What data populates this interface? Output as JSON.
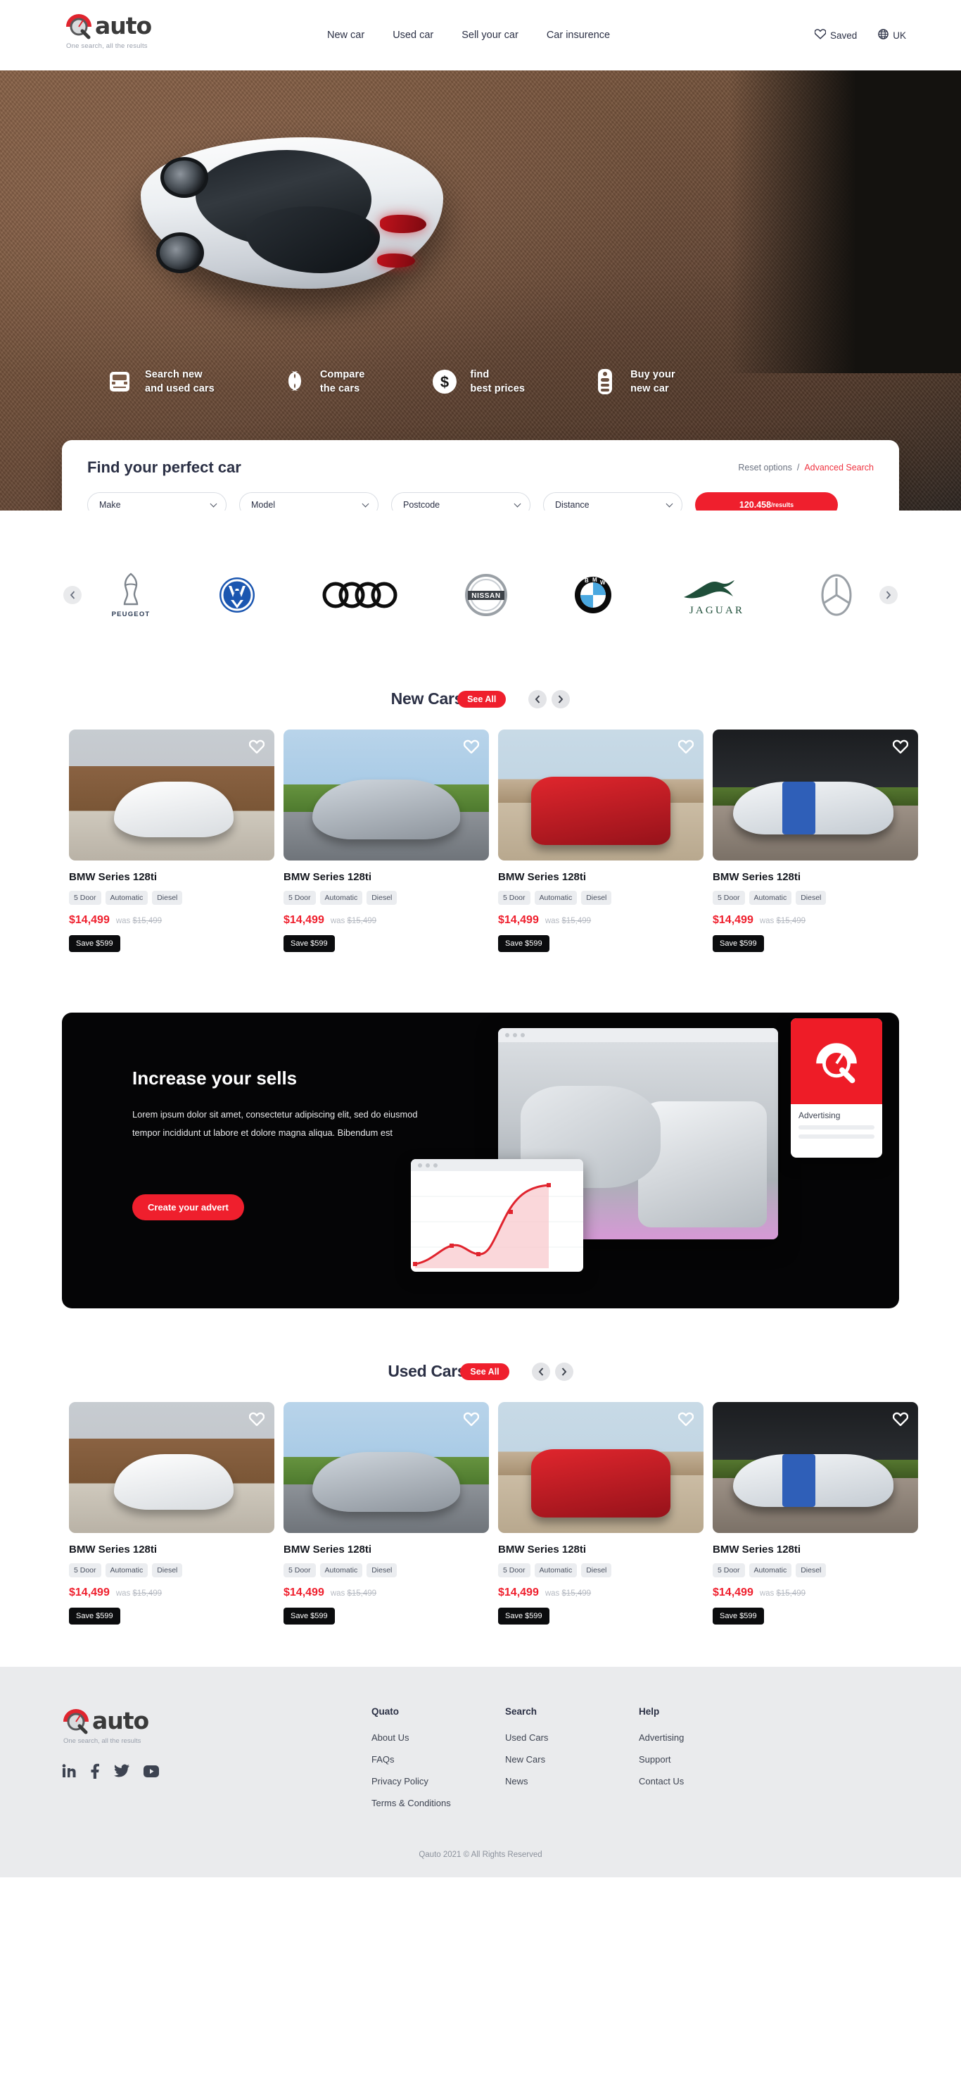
{
  "header": {
    "logo": {
      "text": "auto",
      "tagline": "One search, all the results",
      "icon": "speedometer-search-icon"
    },
    "nav": [
      {
        "label": "New car"
      },
      {
        "label": "Used car"
      },
      {
        "label": "Sell your car"
      },
      {
        "label": "Car insurence"
      }
    ],
    "saved": {
      "label": "Saved",
      "icon": "heart-icon"
    },
    "region": {
      "label": "UK",
      "icon": "globe-icon"
    }
  },
  "hero": {
    "features": [
      {
        "icon": "car-front-icon",
        "line1": "Search new",
        "line2": "and used cars"
      },
      {
        "icon": "compare-arrows-icon",
        "line1": "Compare",
        "line2": "the cars"
      },
      {
        "icon": "dollar-coin-icon",
        "line1": "find",
        "line2": "best prices"
      },
      {
        "icon": "car-key-icon",
        "line1": "Buy your",
        "line2": "new car"
      }
    ]
  },
  "search": {
    "title": "Find your perfect car",
    "reset_label": "Reset options",
    "separator": "/",
    "advanced_label": "Advanced Search",
    "fields": [
      {
        "name": "make",
        "value": "Make"
      },
      {
        "name": "model",
        "value": "Model"
      },
      {
        "name": "postcode",
        "value": "Postcode"
      },
      {
        "name": "distance",
        "value": "Distance"
      }
    ],
    "submit_count": "120.458",
    "submit_suffix": "/results"
  },
  "brands": {
    "prev_icon": "chevron-left-icon",
    "next_icon": "chevron-right-icon",
    "items": [
      {
        "name": "Peugeot",
        "label": "PEUGEOT"
      },
      {
        "name": "Volkswagen",
        "label": "VW"
      },
      {
        "name": "Audi",
        "label": ""
      },
      {
        "name": "Nissan",
        "label": "NISSAN"
      },
      {
        "name": "BMW",
        "label": ""
      },
      {
        "name": "Jaguar",
        "label": "JAGUAR"
      },
      {
        "name": "Mercedes-Benz",
        "label": ""
      }
    ]
  },
  "new_cars": {
    "title": "New Cars",
    "see_all": "See All",
    "prev_icon": "chevron-left-icon",
    "next_icon": "chevron-right-icon",
    "cars": [
      {
        "title": "BMW Series 128ti",
        "chips": [
          "5 Door",
          "Automatic",
          "Diesel"
        ],
        "price": "$14,499",
        "was_label": "was",
        "was_price": "$15,499",
        "save": "Save $599",
        "favourite_icon": "heart-icon"
      },
      {
        "title": "BMW Series 128ti",
        "chips": [
          "5 Door",
          "Automatic",
          "Diesel"
        ],
        "price": "$14,499",
        "was_label": "was",
        "was_price": "$15,499",
        "save": "Save $599",
        "favourite_icon": "heart-icon"
      },
      {
        "title": "BMW Series 128ti",
        "chips": [
          "5 Door",
          "Automatic",
          "Diesel"
        ],
        "price": "$14,499",
        "was_label": "was",
        "was_price": "$15,499",
        "save": "Save $599",
        "favourite_icon": "heart-icon"
      },
      {
        "title": "BMW Series 128ti",
        "chips": [
          "5 Door",
          "Automatic",
          "Diesel"
        ],
        "price": "$14,499",
        "was_label": "was",
        "was_price": "$15,499",
        "save": "Save $599",
        "favourite_icon": "heart-icon"
      }
    ]
  },
  "advert": {
    "title": "Increase your sells",
    "text": "Lorem ipsum dolor sit amet, consectetur adipiscing elit, sed do eiusmod tempor incididunt ut labore et dolore magna aliqua. Bibendum est",
    "button": "Create your advert",
    "card_label": "Advertising",
    "card_icon": "speedometer-search-icon"
  },
  "used_cars": {
    "title": "Used Cars",
    "see_all": "See All",
    "prev_icon": "chevron-left-icon",
    "next_icon": "chevron-right-icon",
    "cars": [
      {
        "title": "BMW Series 128ti",
        "chips": [
          "5 Door",
          "Automatic",
          "Diesel"
        ],
        "price": "$14,499",
        "was_label": "was",
        "was_price": "$15,499",
        "save": "Save $599",
        "favourite_icon": "heart-icon"
      },
      {
        "title": "BMW Series 128ti",
        "chips": [
          "5 Door",
          "Automatic",
          "Diesel"
        ],
        "price": "$14,499",
        "was_label": "was",
        "was_price": "$15,499",
        "save": "Save $599",
        "favourite_icon": "heart-icon"
      },
      {
        "title": "BMW Series 128ti",
        "chips": [
          "5 Door",
          "Automatic",
          "Diesel"
        ],
        "price": "$14,499",
        "was_label": "was",
        "was_price": "$15,499",
        "save": "Save $599",
        "favourite_icon": "heart-icon"
      },
      {
        "title": "BMW Series 128ti",
        "chips": [
          "5 Door",
          "Automatic",
          "Diesel"
        ],
        "price": "$14,499",
        "was_label": "was",
        "was_price": "$15,499",
        "save": "Save $599",
        "favourite_icon": "heart-icon"
      }
    ]
  },
  "footer": {
    "logo": {
      "text": "auto",
      "tagline": "One search, all the results"
    },
    "socials": [
      {
        "name": "linkedin-icon",
        "glyph": "in"
      },
      {
        "name": "facebook-icon",
        "glyph": "f"
      },
      {
        "name": "twitter-icon",
        "glyph": ""
      },
      {
        "name": "youtube-icon",
        "glyph": ""
      }
    ],
    "columns": [
      {
        "head": "Quato",
        "links": [
          "About Us",
          "FAQs",
          "Privacy Policy",
          "Terms & Conditions"
        ]
      },
      {
        "head": "Search",
        "links": [
          "Used Cars",
          "New Cars",
          "News"
        ]
      },
      {
        "head": "Help",
        "links": [
          "Advertising",
          "Support",
          "Contact Us"
        ]
      }
    ],
    "copyright": "Qauto 2021 © All Rights Reserved"
  },
  "colors": {
    "accent_red": "#ef1f2d",
    "dark": "#050506",
    "text": "#2b3045",
    "chip_bg": "#ebedf0",
    "footer_bg": "#eaebed"
  }
}
